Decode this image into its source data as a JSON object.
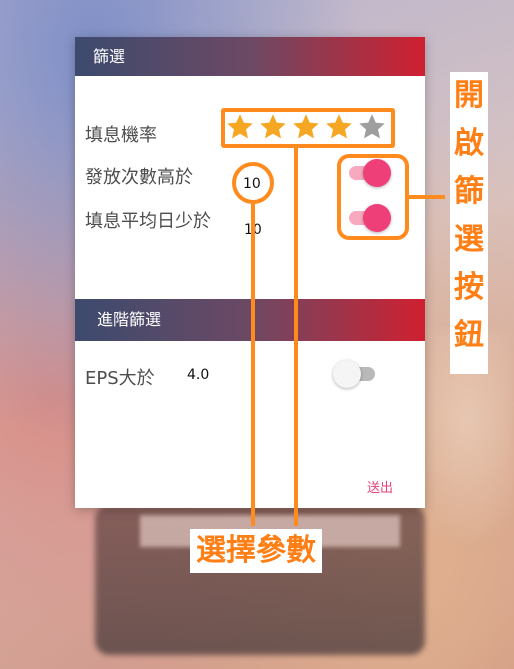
{
  "dialog": {
    "filter_header": "篩選",
    "rating": {
      "label": "填息機率",
      "stars_filled": 4,
      "stars_total": 5
    },
    "rows": [
      {
        "label": "發放次數高於",
        "value": "10",
        "toggle_on": true
      },
      {
        "label": "填息平均日少於",
        "value": "10",
        "toggle_on": true
      }
    ],
    "advanced_header": "進階篩選",
    "eps": {
      "label": "EPS大於",
      "value": "4.0",
      "toggle_on": false
    },
    "submit_label": "送出"
  },
  "annotations": {
    "enable_filter_button": "開啟篩選按鈕",
    "select_parameters": "選擇參數",
    "color": "#ff8a1e"
  },
  "colors": {
    "header_gradient_start": "#3c4a6e",
    "header_gradient_end": "#cf2030",
    "star_filled": "#f5a623",
    "star_empty": "#9e9e9e",
    "toggle_on": "#ef3f79",
    "submit": "#e4417a"
  }
}
